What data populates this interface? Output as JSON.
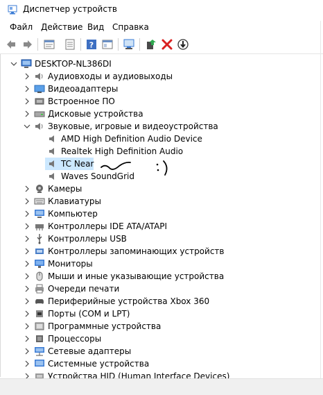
{
  "window": {
    "title": "Диспетчер устройств"
  },
  "menu": [
    "Файл",
    "Действие",
    "Вид",
    "Справка"
  ],
  "toolbar_icons": [
    "back-icon",
    "forward-icon",
    "properties-icon",
    "show-hide-icon",
    "help-icon",
    "details-icon",
    "scan-hardware-icon",
    "update-driver-icon",
    "uninstall-icon",
    "disable-icon"
  ],
  "tree": {
    "root": "DESKTOP-NL386DI",
    "categories": [
      {
        "label": "Аудиовходы и аудиовыходы",
        "icon": "audio-io-icon"
      },
      {
        "label": "Видеоадаптеры",
        "icon": "display-adapter-icon"
      },
      {
        "label": "Встроенное ПО",
        "icon": "firmware-icon"
      },
      {
        "label": "Дисковые устройства",
        "icon": "disk-drive-icon"
      },
      {
        "label": "Звуковые, игровые и видеоустройства",
        "icon": "sound-icon",
        "expanded": true,
        "children": [
          {
            "label": "AMD High Definition Audio Device"
          },
          {
            "label": "Realtek High Definition Audio"
          },
          {
            "label": "TC Near",
            "selected": true
          },
          {
            "label": "Waves SoundGrid"
          }
        ]
      },
      {
        "label": "Камеры",
        "icon": "camera-icon"
      },
      {
        "label": "Клавиатуры",
        "icon": "keyboard-icon"
      },
      {
        "label": "Компьютер",
        "icon": "computer-icon"
      },
      {
        "label": "Контроллеры IDE ATA/ATAPI",
        "icon": "ide-controller-icon"
      },
      {
        "label": "Контроллеры USB",
        "icon": "usb-icon"
      },
      {
        "label": "Контроллеры запоминающих устройств",
        "icon": "storage-controller-icon"
      },
      {
        "label": "Мониторы",
        "icon": "monitor-icon"
      },
      {
        "label": "Мыши и иные указывающие устройства",
        "icon": "mouse-icon"
      },
      {
        "label": "Очереди печати",
        "icon": "printer-icon"
      },
      {
        "label": "Периферийные устройства Xbox 360",
        "icon": "gamepad-icon"
      },
      {
        "label": "Порты (COM и LPT)",
        "icon": "port-icon"
      },
      {
        "label": "Программные устройства",
        "icon": "software-device-icon"
      },
      {
        "label": "Процессоры",
        "icon": "processor-icon"
      },
      {
        "label": "Сетевые адаптеры",
        "icon": "network-adapter-icon"
      },
      {
        "label": "Системные устройства",
        "icon": "system-device-icon"
      },
      {
        "label": "Устройства HID (Human Interface Devices)",
        "icon": "hid-icon"
      }
    ]
  },
  "colors": {
    "selection": "#cce8ff",
    "accent": "#1a5fb4"
  }
}
